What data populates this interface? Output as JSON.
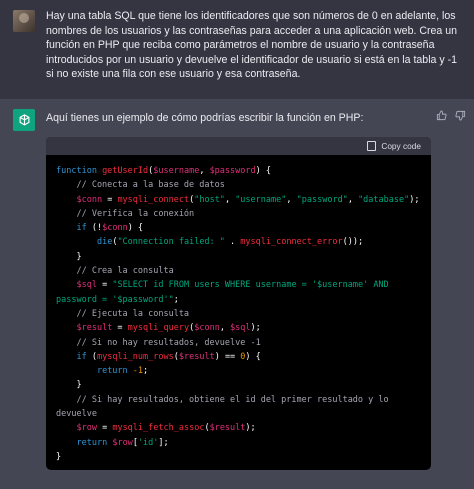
{
  "user_message": "Hay una tabla SQL que tiene los identificadores que son números de 0 en adelante, los nombres de los usuarios y las contraseñas para acceder a una aplicación web. Crea un función en PHP que reciba como parámetros el nombre de usuario y la contraseña introducidos por un usuario y devuelve el identificador de usuario si está en la tabla y -1 si no existe una fila con ese usuario y esa contraseña.",
  "assistant_intro": "Aquí tienes un ejemplo de cómo podrías escribir la función en PHP:",
  "code_block": {
    "copy_label": "Copy code",
    "lines": [
      [
        [
          "k",
          "function "
        ],
        [
          "f",
          "getUserId"
        ],
        [
          "p",
          "("
        ],
        [
          "v",
          "$username"
        ],
        [
          "p",
          ", "
        ],
        [
          "v",
          "$password"
        ],
        [
          "p",
          ") {"
        ]
      ],
      [
        [
          "cm",
          "    // Conecta a la base de datos"
        ]
      ],
      [
        [
          "p",
          "    "
        ],
        [
          "v",
          "$conn"
        ],
        [
          "p",
          " = "
        ],
        [
          "f",
          "mysqli_connect"
        ],
        [
          "p",
          "("
        ],
        [
          "s",
          "\"host\""
        ],
        [
          "p",
          ", "
        ],
        [
          "s",
          "\"username\""
        ],
        [
          "p",
          ", "
        ],
        [
          "s",
          "\"password\""
        ],
        [
          "p",
          ", "
        ],
        [
          "s",
          "\"database\""
        ],
        [
          "p",
          ");"
        ]
      ],
      [
        [
          "cm",
          "    // Verifica la conexión"
        ]
      ],
      [
        [
          "p",
          "    "
        ],
        [
          "k",
          "if"
        ],
        [
          "p",
          " (!"
        ],
        [
          "v",
          "$conn"
        ],
        [
          "p",
          ") {"
        ]
      ],
      [
        [
          "p",
          "        "
        ],
        [
          "k",
          "die"
        ],
        [
          "p",
          "("
        ],
        [
          "s",
          "\"Connection failed: \""
        ],
        [
          "p",
          " . "
        ],
        [
          "f",
          "mysqli_connect_error"
        ],
        [
          "p",
          "());"
        ]
      ],
      [
        [
          "p",
          "    }"
        ]
      ],
      [
        [
          "cm",
          "    // Crea la consulta"
        ]
      ],
      [
        [
          "p",
          "    "
        ],
        [
          "v",
          "$sql"
        ],
        [
          "p",
          " = "
        ],
        [
          "s",
          "\"SELECT id FROM users WHERE username = '$username' AND"
        ]
      ],
      [
        [
          "s",
          "password = '$password'\""
        ],
        [
          "p",
          ";"
        ]
      ],
      [
        [
          "cm",
          "    // Ejecuta la consulta"
        ]
      ],
      [
        [
          "p",
          "    "
        ],
        [
          "v",
          "$result"
        ],
        [
          "p",
          " = "
        ],
        [
          "f",
          "mysqli_query"
        ],
        [
          "p",
          "("
        ],
        [
          "v",
          "$conn"
        ],
        [
          "p",
          ", "
        ],
        [
          "v",
          "$sql"
        ],
        [
          "p",
          ");"
        ]
      ],
      [
        [
          "cm",
          "    // Si no hay resultados, devuelve -1"
        ]
      ],
      [
        [
          "p",
          "    "
        ],
        [
          "k",
          "if"
        ],
        [
          "p",
          " ("
        ],
        [
          "f",
          "mysqli_num_rows"
        ],
        [
          "p",
          "("
        ],
        [
          "v",
          "$result"
        ],
        [
          "p",
          ") == "
        ],
        [
          "c",
          "0"
        ],
        [
          "p",
          ") {"
        ]
      ],
      [
        [
          "p",
          "        "
        ],
        [
          "k",
          "return"
        ],
        [
          "p",
          " "
        ],
        [
          "c",
          "-1"
        ],
        [
          "p",
          ";"
        ]
      ],
      [
        [
          "p",
          "    }"
        ]
      ],
      [
        [
          "cm",
          "    // Si hay resultados, obtiene el id del primer resultado y lo"
        ]
      ],
      [
        [
          "cm",
          "devuelve"
        ]
      ],
      [
        [
          "p",
          "    "
        ],
        [
          "v",
          "$row"
        ],
        [
          "p",
          " = "
        ],
        [
          "f",
          "mysqli_fetch_assoc"
        ],
        [
          "p",
          "("
        ],
        [
          "v",
          "$result"
        ],
        [
          "p",
          ");"
        ]
      ],
      [
        [
          "p",
          "    "
        ],
        [
          "k",
          "return"
        ],
        [
          "p",
          " "
        ],
        [
          "v",
          "$row"
        ],
        [
          "p",
          "["
        ],
        [
          "s",
          "'id'"
        ],
        [
          "p",
          "];"
        ]
      ],
      [
        [
          "p",
          "}"
        ]
      ]
    ]
  },
  "icons": {
    "user_avatar": "user-avatar",
    "assistant_avatar": "openai-logo-icon",
    "thumbs_up": "thumbs-up-icon",
    "thumbs_down": "thumbs-down-icon",
    "copy": "clipboard-icon"
  },
  "colors": {
    "user_bg": "#343541",
    "assistant_bg": "#444654",
    "code_bg": "#000000",
    "accent": "#10a37f"
  }
}
